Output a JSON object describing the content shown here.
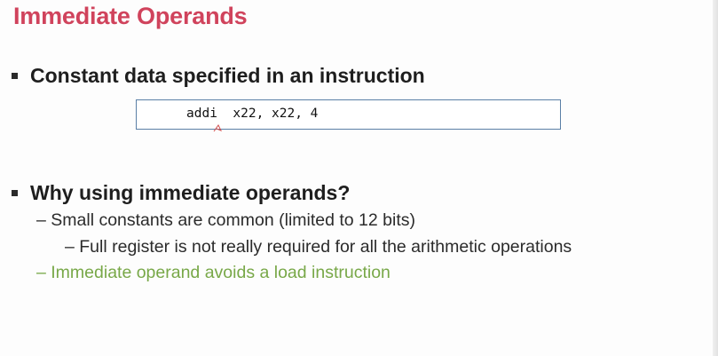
{
  "slide": {
    "title": "Immediate Operands",
    "bullets": [
      {
        "text": "Constant data specified in an instruction"
      },
      {
        "text": "Why using immediate operands?"
      }
    ],
    "code": "addi  x22, x22, 4",
    "sub_items": [
      "– Small constants are common (limited to 12 bits)",
      "– Full register is not really required for all the arithmetic operations",
      "– Immediate operand avoids a load instruction"
    ],
    "colors": {
      "title": "#d0435c",
      "highlight": "#78a848",
      "code_border": "#5a7fa6"
    }
  }
}
